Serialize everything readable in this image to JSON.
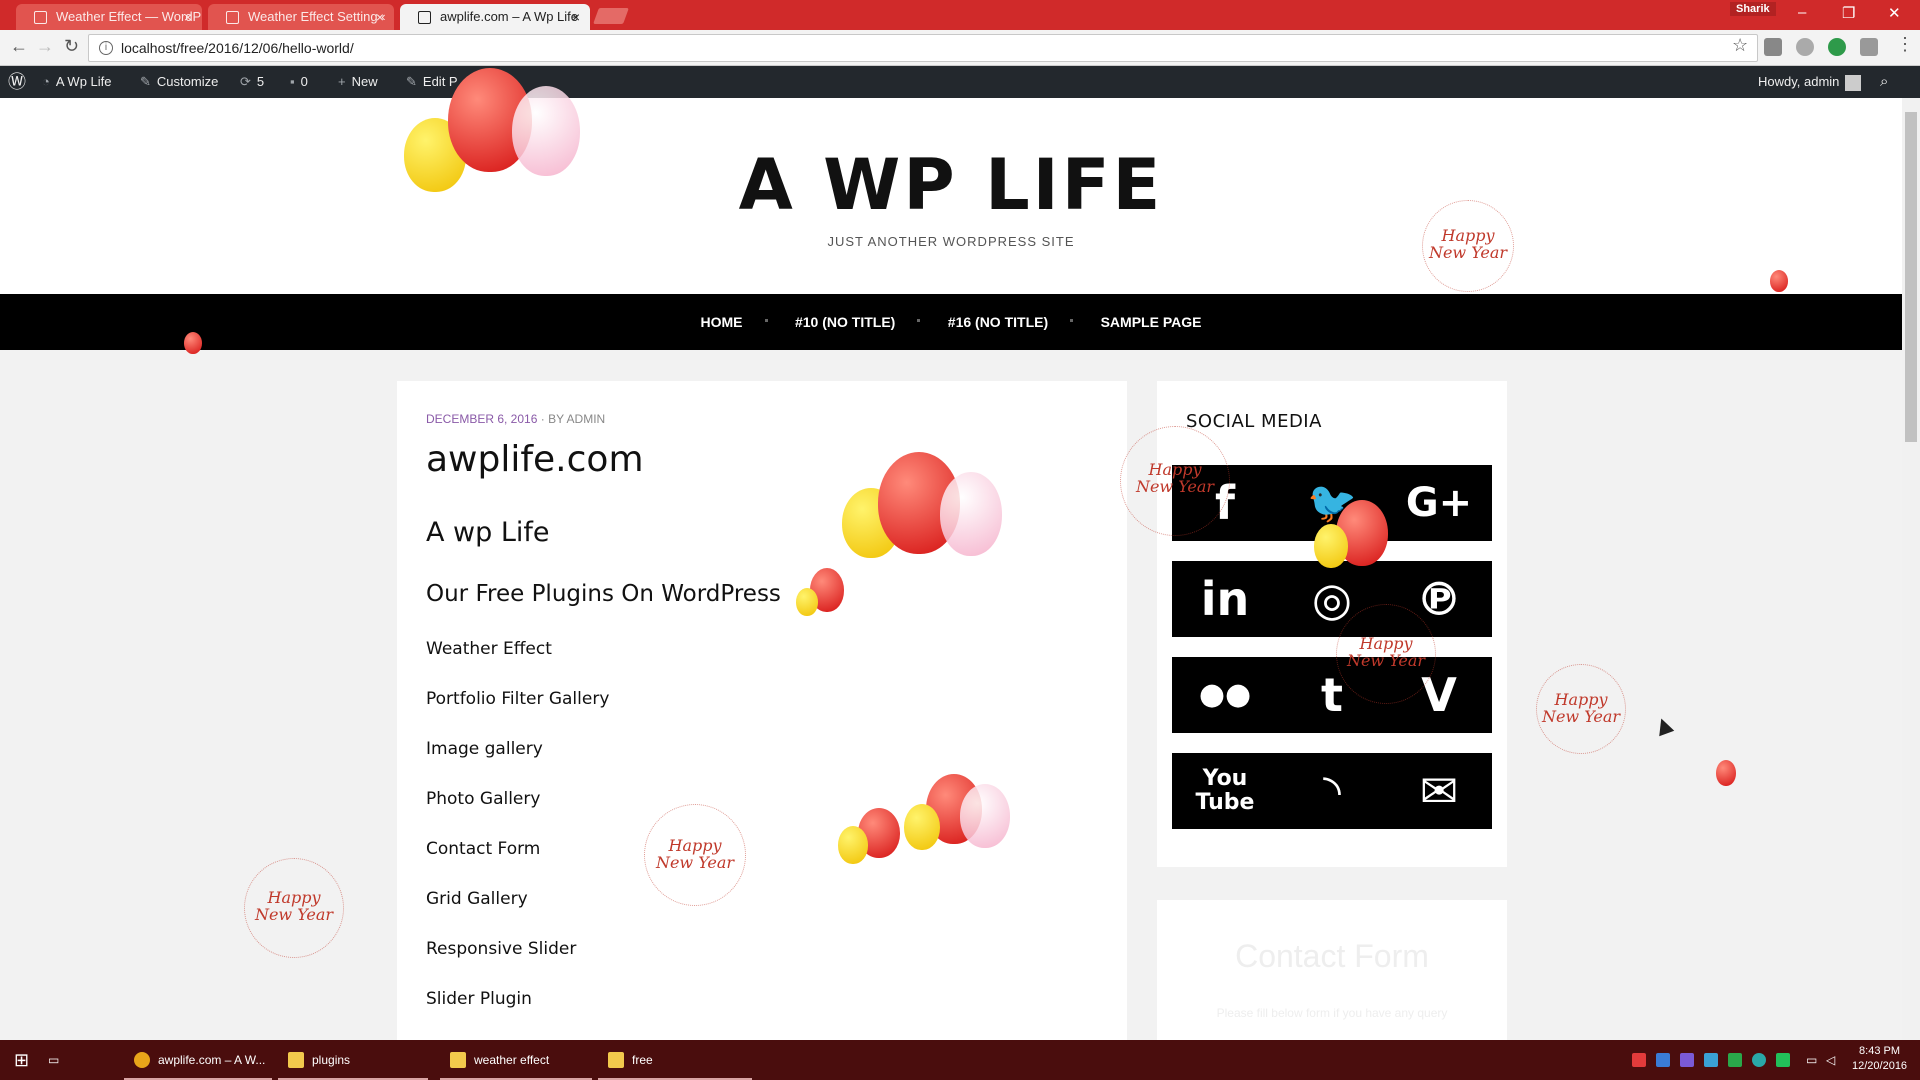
{
  "browser": {
    "tabs": [
      {
        "title": "Weather Effect — WordP",
        "active": false
      },
      {
        "title": "Weather Effect Setting ‹",
        "active": false
      },
      {
        "title": "awplife.com – A Wp Life",
        "active": true
      }
    ],
    "profile_name": "Sharik",
    "url": "localhost/free/2016/12/06/hello-world/"
  },
  "admin_bar": {
    "site_name": "A Wp Life",
    "customize": "Customize",
    "updates_count": "5",
    "comments_count": "0",
    "new_label": "New",
    "edit_label": "Edit P",
    "greeting": "Howdy, admin"
  },
  "site": {
    "title": "A WP LIFE",
    "tagline": "JUST ANOTHER WORDPRESS SITE"
  },
  "nav": {
    "items": [
      "HOME",
      "#10 (NO TITLE)",
      "#16 (NO TITLE)",
      "SAMPLE PAGE"
    ]
  },
  "post": {
    "date": "DECEMBER 6, 2016",
    "by": "BY",
    "author": "ADMIN",
    "title": "awplife.com",
    "heading": "A wp Life",
    "subheading": "Our Free Plugins On WordPress",
    "plugins": [
      "Weather Effect",
      "Portfolio Filter Gallery",
      "Image gallery",
      "Photo Gallery",
      "Contact Form",
      "Grid Gallery",
      "Responsive Slider",
      "Slider Plugin"
    ]
  },
  "sidebar": {
    "social_title": "SOCIAL MEDIA",
    "social_icons": [
      [
        "facebook-icon",
        "twitter-icon",
        "google-plus-icon"
      ],
      [
        "linkedin-icon",
        "instagram-icon",
        "pinterest-icon"
      ],
      [
        "flickr-icon",
        "tumblr-icon",
        "vimeo-icon"
      ],
      [
        "youtube-icon",
        "rss-icon",
        "email-icon"
      ]
    ],
    "social_glyphs": [
      [
        "f",
        "🐦",
        "G+"
      ],
      [
        "in",
        "◎",
        "℗"
      ],
      [
        "●●",
        "t",
        "V"
      ],
      [
        "You\nTube",
        "◝",
        "✉"
      ]
    ],
    "contact_title": "Contact Form",
    "contact_text": "Please fill below form if you have any query"
  },
  "decorations": {
    "happy_new_year": "Happy\nNew Year"
  },
  "taskbar": {
    "items": [
      {
        "label": "awplife.com – A W...",
        "icon": "chrome-icon"
      },
      {
        "label": "plugins",
        "icon": "folder-icon"
      },
      {
        "label": "weather effect",
        "icon": "folder-icon"
      },
      {
        "label": "free",
        "icon": "folder-icon"
      }
    ],
    "time": "8:43 PM",
    "date": "12/20/2016"
  },
  "colors": {
    "titlebar": "#d02a2a",
    "admin_bar": "#23282d",
    "nav": "#000000",
    "taskbar": "#4a0d0d",
    "meta_date": "#8a5aa8"
  }
}
